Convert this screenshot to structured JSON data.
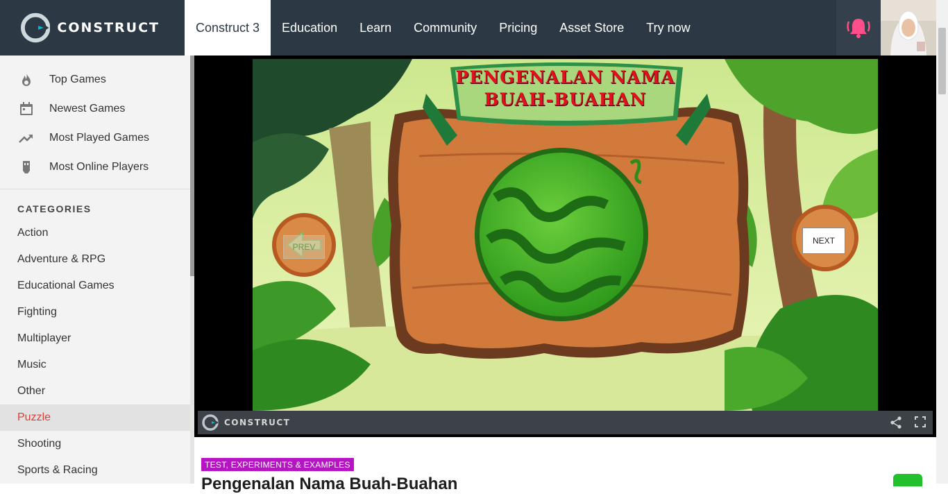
{
  "brand": {
    "name": "CONSTRUCT"
  },
  "nav": {
    "items": [
      {
        "label": "Construct 3",
        "active": true
      },
      {
        "label": "Education"
      },
      {
        "label": "Learn"
      },
      {
        "label": "Community"
      },
      {
        "label": "Pricing"
      },
      {
        "label": "Asset Store"
      },
      {
        "label": "Try now"
      }
    ]
  },
  "sidebar": {
    "quick": [
      {
        "label": "Top Games",
        "icon": "flame-icon"
      },
      {
        "label": "Newest Games",
        "icon": "calendar-icon"
      },
      {
        "label": "Most Played Games",
        "icon": "trending-up-icon"
      },
      {
        "label": "Most Online Players",
        "icon": "controller-icon"
      }
    ],
    "categories_title": "CATEGORIES",
    "categories": [
      {
        "label": "Action"
      },
      {
        "label": "Adventure & RPG"
      },
      {
        "label": "Educational Games"
      },
      {
        "label": "Fighting"
      },
      {
        "label": "Multiplayer"
      },
      {
        "label": "Music"
      },
      {
        "label": "Other"
      },
      {
        "label": "Puzzle",
        "active": true
      },
      {
        "label": "Shooting"
      },
      {
        "label": "Sports & Racing"
      }
    ]
  },
  "game": {
    "title_line1": "PENGENALAN NAMA",
    "title_line2": "BUAH-BUAHAN",
    "prev_label": "PREV",
    "next_label": "NEXT",
    "footer_brand": "CONSTRUCT"
  },
  "details": {
    "tag": "TEST, EXPERIMENTS & EXAMPLES",
    "title": "Pengenalan Nama Buah-Buahan"
  },
  "colors": {
    "topbar": "#2c3944",
    "active_category": "#e53935",
    "tag": "#b515c2",
    "bell": "#ff4f8b"
  }
}
